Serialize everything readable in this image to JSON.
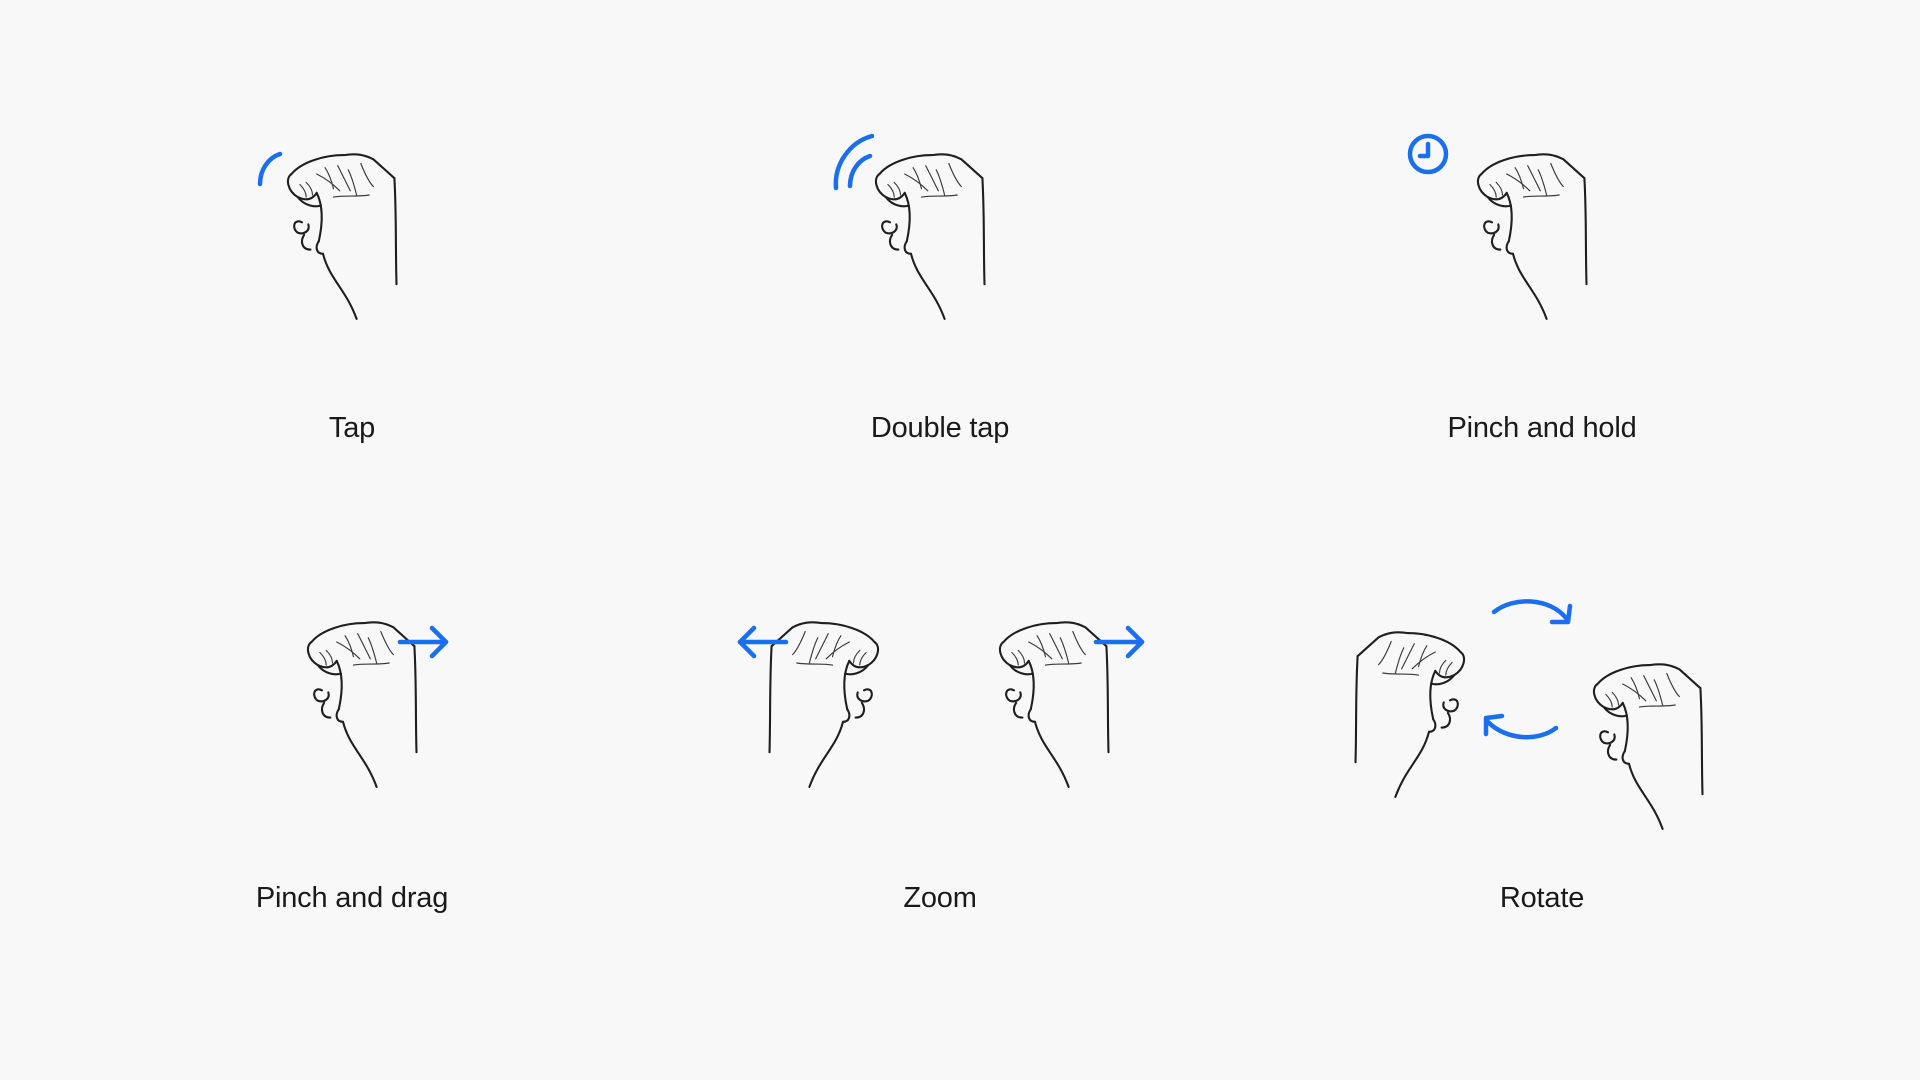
{
  "colors": {
    "background": "#f8f8f8",
    "accent": "#1a6ef0",
    "line": "#1f1f1f",
    "text": "#1a1a1a"
  },
  "gestures": [
    {
      "label": "Tap",
      "icons": [
        "hand-pinch-icon",
        "tap-wave-single-icon"
      ]
    },
    {
      "label": "Double tap",
      "icons": [
        "hand-pinch-icon",
        "tap-wave-double-icon"
      ]
    },
    {
      "label": "Pinch and hold",
      "icons": [
        "hand-pinch-icon",
        "clock-icon"
      ]
    },
    {
      "label": "Pinch and drag",
      "icons": [
        "hand-pinch-icon",
        "arrow-right-icon"
      ]
    },
    {
      "label": "Zoom",
      "icons": [
        "hand-pinch-icon",
        "hand-pinch-mirrored-icon",
        "arrow-left-icon",
        "arrow-right-icon"
      ]
    },
    {
      "label": "Rotate",
      "icons": [
        "hand-pinch-icon",
        "hand-pinch-mirrored-icon",
        "rotate-arrows-icon"
      ]
    }
  ]
}
